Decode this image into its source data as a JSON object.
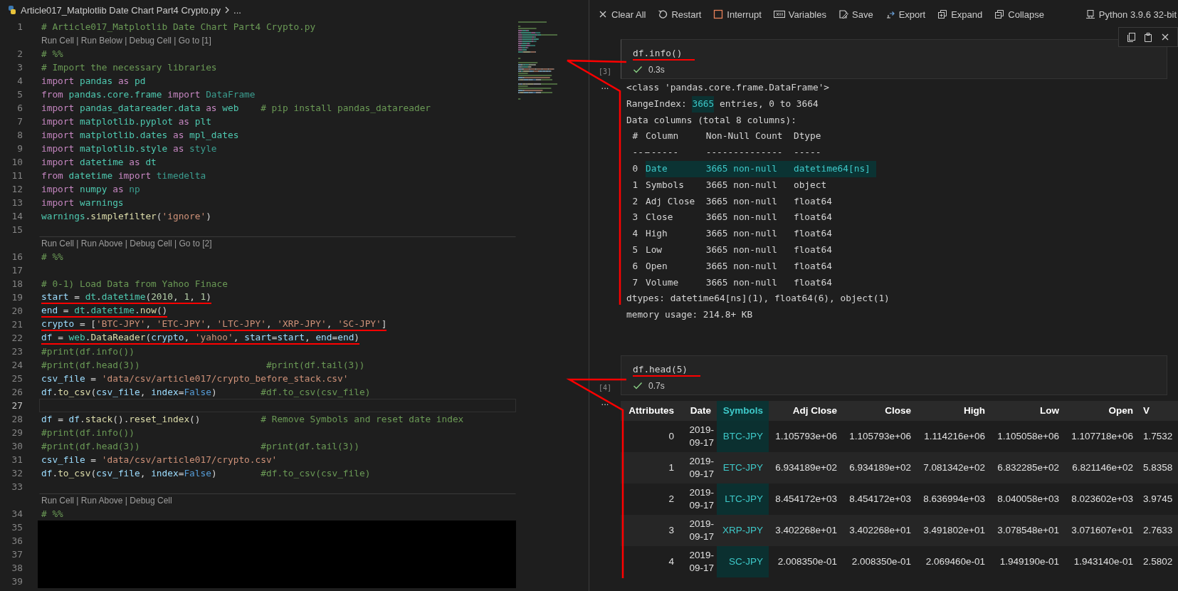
{
  "editor": {
    "breadcrumb": "Article017_Matplotlib Date Chart Part4 Crypto.py",
    "breadcrumb_more": "...",
    "lines": [
      {
        "kind": "code",
        "number": "1",
        "current": false,
        "underlined": false,
        "tokens": [
          {
            "kind": "comment",
            "text": "# Article017_Matplotlib Date Chart Part4 Crypto.py"
          }
        ]
      },
      {
        "kind": "codelens",
        "text": "Run Cell | Run Below | Debug Cell | Go to [1]"
      },
      {
        "kind": "code",
        "number": "2",
        "current": false,
        "underlined": false,
        "tokens": [
          {
            "kind": "comment",
            "text": "# %%"
          }
        ]
      },
      {
        "kind": "code",
        "number": "3",
        "current": false,
        "underlined": false,
        "tokens": [
          {
            "kind": "comment",
            "text": "# Import the necessary libraries"
          }
        ]
      },
      {
        "kind": "code",
        "number": "4",
        "current": false,
        "underlined": false,
        "tokens": [
          {
            "kind": "keyword",
            "text": "import "
          },
          {
            "kind": "module",
            "text": "pandas "
          },
          {
            "kind": "keyword",
            "text": "as "
          },
          {
            "kind": "module",
            "text": "pd"
          }
        ]
      },
      {
        "kind": "code",
        "number": "5",
        "current": false,
        "underlined": false,
        "tokens": [
          {
            "kind": "keyword",
            "text": "from "
          },
          {
            "kind": "module",
            "text": "pandas.core.frame "
          },
          {
            "kind": "keyword",
            "text": "import "
          },
          {
            "kind": "unresolved",
            "text": "DataFrame"
          }
        ]
      },
      {
        "kind": "code",
        "number": "6",
        "current": false,
        "underlined": false,
        "tokens": [
          {
            "kind": "keyword",
            "text": "import "
          },
          {
            "kind": "module",
            "text": "pandas_datareader.data "
          },
          {
            "kind": "keyword",
            "text": "as "
          },
          {
            "kind": "module",
            "text": "web    "
          },
          {
            "kind": "comment",
            "text": "# pip install pandas_datareader"
          }
        ]
      },
      {
        "kind": "code",
        "number": "7",
        "current": false,
        "underlined": false,
        "tokens": [
          {
            "kind": "keyword",
            "text": "import "
          },
          {
            "kind": "module",
            "text": "matplotlib.pyplot "
          },
          {
            "kind": "keyword",
            "text": "as "
          },
          {
            "kind": "module",
            "text": "plt"
          }
        ]
      },
      {
        "kind": "code",
        "number": "8",
        "current": false,
        "underlined": false,
        "tokens": [
          {
            "kind": "keyword",
            "text": "import "
          },
          {
            "kind": "module",
            "text": "matplotlib.dates "
          },
          {
            "kind": "keyword",
            "text": "as "
          },
          {
            "kind": "module",
            "text": "mpl_dates"
          }
        ]
      },
      {
        "kind": "code",
        "number": "9",
        "current": false,
        "underlined": false,
        "tokens": [
          {
            "kind": "keyword",
            "text": "import "
          },
          {
            "kind": "module",
            "text": "matplotlib.style "
          },
          {
            "kind": "keyword",
            "text": "as "
          },
          {
            "kind": "unresolved",
            "text": "style"
          }
        ]
      },
      {
        "kind": "code",
        "number": "10",
        "current": false,
        "underlined": false,
        "tokens": [
          {
            "kind": "keyword",
            "text": "import "
          },
          {
            "kind": "module",
            "text": "datetime "
          },
          {
            "kind": "keyword",
            "text": "as "
          },
          {
            "kind": "module",
            "text": "dt"
          }
        ]
      },
      {
        "kind": "code",
        "number": "11",
        "current": false,
        "underlined": false,
        "tokens": [
          {
            "kind": "keyword",
            "text": "from "
          },
          {
            "kind": "module",
            "text": "datetime "
          },
          {
            "kind": "keyword",
            "text": "import "
          },
          {
            "kind": "unresolved",
            "text": "timedelta"
          }
        ]
      },
      {
        "kind": "code",
        "number": "12",
        "current": false,
        "underlined": false,
        "tokens": [
          {
            "kind": "keyword",
            "text": "import "
          },
          {
            "kind": "module",
            "text": "numpy "
          },
          {
            "kind": "keyword",
            "text": "as "
          },
          {
            "kind": "unresolved",
            "text": "np"
          }
        ]
      },
      {
        "kind": "code",
        "number": "13",
        "current": false,
        "underlined": false,
        "tokens": [
          {
            "kind": "keyword",
            "text": "import "
          },
          {
            "kind": "module",
            "text": "warnings"
          }
        ]
      },
      {
        "kind": "code",
        "number": "14",
        "current": false,
        "underlined": false,
        "tokens": [
          {
            "kind": "module",
            "text": "warnings"
          },
          {
            "kind": "plain",
            "text": "."
          },
          {
            "kind": "function",
            "text": "simplefilter"
          },
          {
            "kind": "plain",
            "text": "("
          },
          {
            "kind": "string",
            "text": "'ignore'"
          },
          {
            "kind": "plain",
            "text": ")"
          }
        ]
      },
      {
        "kind": "code",
        "number": "15",
        "current": false
      },
      {
        "kind": "codelens",
        "text": "Run Cell | Run Above | Debug Cell | Go to [2]"
      },
      {
        "kind": "code",
        "number": "16",
        "current": false,
        "underlined": false,
        "tokens": [
          {
            "kind": "comment",
            "text": "# %%"
          }
        ]
      },
      {
        "kind": "code",
        "number": "17",
        "current": false
      },
      {
        "kind": "code",
        "number": "18",
        "current": false,
        "underlined": false,
        "tokens": [
          {
            "kind": "comment",
            "text": "# 0-1) Load Data from Yahoo Finace"
          }
        ]
      },
      {
        "kind": "code",
        "number": "19",
        "current": false,
        "underlined": true,
        "tokens": [
          {
            "kind": "variable",
            "text": "start"
          },
          {
            "kind": "plain",
            "text": " = "
          },
          {
            "kind": "module",
            "text": "dt"
          },
          {
            "kind": "plain",
            "text": "."
          },
          {
            "kind": "module",
            "text": "datetime"
          },
          {
            "kind": "plain",
            "text": "("
          },
          {
            "kind": "number",
            "text": "2010"
          },
          {
            "kind": "plain",
            "text": ", "
          },
          {
            "kind": "number",
            "text": "1"
          },
          {
            "kind": "plain",
            "text": ", "
          },
          {
            "kind": "number",
            "text": "1"
          },
          {
            "kind": "plain",
            "text": ")"
          }
        ]
      },
      {
        "kind": "code",
        "number": "20",
        "current": false,
        "underlined": true,
        "tokens": [
          {
            "kind": "variable",
            "text": "end"
          },
          {
            "kind": "plain",
            "text": " = "
          },
          {
            "kind": "module",
            "text": "dt"
          },
          {
            "kind": "plain",
            "text": "."
          },
          {
            "kind": "module",
            "text": "datetime"
          },
          {
            "kind": "plain",
            "text": "."
          },
          {
            "kind": "function",
            "text": "now"
          },
          {
            "kind": "plain",
            "text": "()"
          }
        ]
      },
      {
        "kind": "code",
        "number": "21",
        "current": false,
        "underlined": true,
        "tokens": [
          {
            "kind": "variable",
            "text": "crypto"
          },
          {
            "kind": "plain",
            "text": " = ["
          },
          {
            "kind": "string",
            "text": "'BTC-JPY'"
          },
          {
            "kind": "plain",
            "text": ", "
          },
          {
            "kind": "string",
            "text": "'ETC-JPY'"
          },
          {
            "kind": "plain",
            "text": ", "
          },
          {
            "kind": "string",
            "text": "'LTC-JPY'"
          },
          {
            "kind": "plain",
            "text": ", "
          },
          {
            "kind": "string",
            "text": "'XRP-JPY'"
          },
          {
            "kind": "plain",
            "text": ", "
          },
          {
            "kind": "string",
            "text": "'SC-JPY'"
          },
          {
            "kind": "plain",
            "text": "]"
          }
        ]
      },
      {
        "kind": "code",
        "number": "22",
        "current": false,
        "underlined": true,
        "tokens": [
          {
            "kind": "variable",
            "text": "df"
          },
          {
            "kind": "plain",
            "text": " = "
          },
          {
            "kind": "module",
            "text": "web"
          },
          {
            "kind": "plain",
            "text": "."
          },
          {
            "kind": "function",
            "text": "DataReader"
          },
          {
            "kind": "plain",
            "text": "("
          },
          {
            "kind": "variable",
            "text": "crypto"
          },
          {
            "kind": "plain",
            "text": ", "
          },
          {
            "kind": "string",
            "text": "'yahoo'"
          },
          {
            "kind": "plain",
            "text": ", "
          },
          {
            "kind": "variable",
            "text": "start"
          },
          {
            "kind": "plain",
            "text": "="
          },
          {
            "kind": "variable",
            "text": "start"
          },
          {
            "kind": "plain",
            "text": ", "
          },
          {
            "kind": "variable",
            "text": "end"
          },
          {
            "kind": "plain",
            "text": "="
          },
          {
            "kind": "variable",
            "text": "end"
          },
          {
            "kind": "plain",
            "text": ")"
          }
        ]
      },
      {
        "kind": "code",
        "number": "23",
        "current": false,
        "underlined": false,
        "tokens": [
          {
            "kind": "comment",
            "text": "#print(df.info())"
          }
        ]
      },
      {
        "kind": "code",
        "number": "24",
        "current": false,
        "underlined": false,
        "tokens": [
          {
            "kind": "comment",
            "text": "#print(df.head(3))                       #print(df.tail(3))"
          }
        ]
      },
      {
        "kind": "code",
        "number": "25",
        "current": false,
        "underlined": false,
        "tokens": [
          {
            "kind": "variable",
            "text": "csv_file"
          },
          {
            "kind": "plain",
            "text": " = "
          },
          {
            "kind": "string",
            "text": "'data/csv/article017/crypto_before_stack.csv'"
          }
        ]
      },
      {
        "kind": "code",
        "number": "26",
        "current": false,
        "underlined": false,
        "tokens": [
          {
            "kind": "variable",
            "text": "df"
          },
          {
            "kind": "plain",
            "text": "."
          },
          {
            "kind": "function",
            "text": "to_csv"
          },
          {
            "kind": "plain",
            "text": "("
          },
          {
            "kind": "variable",
            "text": "csv_file"
          },
          {
            "kind": "plain",
            "text": ", "
          },
          {
            "kind": "variable",
            "text": "index"
          },
          {
            "kind": "plain",
            "text": "="
          },
          {
            "kind": "constant",
            "text": "False"
          },
          {
            "kind": "plain",
            "text": ")        "
          },
          {
            "kind": "comment",
            "text": "#df.to_csv(csv_file)"
          }
        ]
      },
      {
        "kind": "code",
        "number": "27",
        "current": true
      },
      {
        "kind": "code",
        "number": "28",
        "current": false,
        "underlined": false,
        "tokens": [
          {
            "kind": "variable",
            "text": "df"
          },
          {
            "kind": "plain",
            "text": " = "
          },
          {
            "kind": "variable",
            "text": "df"
          },
          {
            "kind": "plain",
            "text": "."
          },
          {
            "kind": "function",
            "text": "stack"
          },
          {
            "kind": "plain",
            "text": "()."
          },
          {
            "kind": "function",
            "text": "reset_index"
          },
          {
            "kind": "plain",
            "text": "()           "
          },
          {
            "kind": "comment",
            "text": "# Remove Symbols and reset date index"
          }
        ]
      },
      {
        "kind": "code",
        "number": "29",
        "current": false,
        "underlined": false,
        "tokens": [
          {
            "kind": "comment",
            "text": "#print(df.info())"
          }
        ]
      },
      {
        "kind": "code",
        "number": "30",
        "current": false,
        "underlined": false,
        "tokens": [
          {
            "kind": "comment",
            "text": "#print(df.head(3))                      #print(df.tail(3))"
          }
        ]
      },
      {
        "kind": "code",
        "number": "31",
        "current": false,
        "underlined": false,
        "tokens": [
          {
            "kind": "variable",
            "text": "csv_file"
          },
          {
            "kind": "plain",
            "text": " = "
          },
          {
            "kind": "string",
            "text": "'data/csv/article017/crypto.csv'"
          }
        ]
      },
      {
        "kind": "code",
        "number": "32",
        "current": false,
        "underlined": false,
        "tokens": [
          {
            "kind": "variable",
            "text": "df"
          },
          {
            "kind": "plain",
            "text": "."
          },
          {
            "kind": "function",
            "text": "to_csv"
          },
          {
            "kind": "plain",
            "text": "("
          },
          {
            "kind": "variable",
            "text": "csv_file"
          },
          {
            "kind": "plain",
            "text": ", "
          },
          {
            "kind": "variable",
            "text": "index"
          },
          {
            "kind": "plain",
            "text": "="
          },
          {
            "kind": "constant",
            "text": "False"
          },
          {
            "kind": "plain",
            "text": ")        "
          },
          {
            "kind": "comment",
            "text": "#df.to_csv(csv_file)"
          }
        ]
      },
      {
        "kind": "code",
        "number": "33",
        "current": false
      },
      {
        "kind": "codelens",
        "text": "Run Cell | Run Above | Debug Cell"
      },
      {
        "kind": "code",
        "number": "34",
        "current": false,
        "underlined": false,
        "tokens": [
          {
            "kind": "comment",
            "text": "# %%"
          }
        ]
      },
      {
        "kind": "covered",
        "number": "35"
      },
      {
        "kind": "covered",
        "number": "36"
      },
      {
        "kind": "covered",
        "number": "37"
      },
      {
        "kind": "covered",
        "number": "38"
      },
      {
        "kind": "covered",
        "number": "39"
      }
    ]
  },
  "toolbar": {
    "items": [
      "Clear All",
      "Restart",
      "Interrupt",
      "Variables",
      "Save",
      "Export",
      "Expand",
      "Collapse"
    ],
    "kernel": "Python 3.9.6 32-bit"
  },
  "cells": [
    {
      "kind": "info",
      "selected": true,
      "execution_count": "[3]",
      "source": "df.info()",
      "underlined": true,
      "success": true,
      "duration": "0.3s",
      "output_marker": "...",
      "output": {
        "lines_before": [
          [
            {
              "text": "<class 'pandas.core.frame.DataFrame'>",
              "highlighted": false
            }
          ],
          [
            {
              "text": "RangeIndex: ",
              "highlighted": false
            },
            {
              "text": "3665",
              "highlighted": true
            },
            {
              "text": " entries, 0 to 3664",
              "highlighted": false
            }
          ],
          [
            {
              "text": "Data columns (total 8 columns):",
              "highlighted": false
            }
          ]
        ],
        "header": [
          "#",
          "Column",
          "Non-Null Count",
          "Dtype"
        ],
        "rule": [
          "---",
          "------",
          "--------------",
          "-----"
        ],
        "rows": [
          {
            "index": "0",
            "column": "Date",
            "count": "3665 non-null",
            "dtype": "datetime64[ns]",
            "highlighted": true
          },
          {
            "index": "1",
            "column": "Symbols",
            "count": "3665 non-null",
            "dtype": "object",
            "highlighted": false
          },
          {
            "index": "2",
            "column": "Adj Close",
            "count": "3665 non-null",
            "dtype": "float64",
            "highlighted": false
          },
          {
            "index": "3",
            "column": "Close",
            "count": "3665 non-null",
            "dtype": "float64",
            "highlighted": false
          },
          {
            "index": "4",
            "column": "High",
            "count": "3665 non-null",
            "dtype": "float64",
            "highlighted": false
          },
          {
            "index": "5",
            "column": "Low",
            "count": "3665 non-null",
            "dtype": "float64",
            "highlighted": false
          },
          {
            "index": "6",
            "column": "Open",
            "count": "3665 non-null",
            "dtype": "float64",
            "highlighted": false
          },
          {
            "index": "7",
            "column": "Volume",
            "count": "3665 non-null",
            "dtype": "float64",
            "highlighted": false
          }
        ],
        "lines_after": [
          "dtypes: datetime64[ns](1), float64(6), object(1)",
          "memory usage: 214.8+ KB"
        ]
      }
    },
    {
      "kind": "table",
      "selected": false,
      "execution_count": "[4]",
      "source": "df.head(5)",
      "underlined": true,
      "success": true,
      "duration": "0.7s",
      "output_marker": "...",
      "columns": [
        {
          "label": "Attributes",
          "highlighted": false
        },
        {
          "label": "Date",
          "highlighted": false
        },
        {
          "label": "Symbols",
          "highlighted": true
        },
        {
          "label": "Adj Close",
          "highlighted": false
        },
        {
          "label": "Close",
          "highlighted": false
        },
        {
          "label": "High",
          "highlighted": false
        },
        {
          "label": "Low",
          "highlighted": false
        },
        {
          "label": "Open",
          "highlighted": false
        },
        {
          "label": "V",
          "highlighted": false
        }
      ],
      "rows": [
        [
          "0",
          "2019-09-17",
          "BTC-JPY",
          "1.105793e+06",
          "1.105793e+06",
          "1.114216e+06",
          "1.105058e+06",
          "1.107718e+06",
          "1.7532"
        ],
        [
          "1",
          "2019-09-17",
          "ETC-JPY",
          "6.934189e+02",
          "6.934189e+02",
          "7.081342e+02",
          "6.832285e+02",
          "6.821146e+02",
          "5.8358"
        ],
        [
          "2",
          "2019-09-17",
          "LTC-JPY",
          "8.454172e+03",
          "8.454172e+03",
          "8.636994e+03",
          "8.040058e+03",
          "8.023602e+03",
          "3.9745"
        ],
        [
          "3",
          "2019-09-17",
          "XRP-JPY",
          "3.402268e+01",
          "3.402268e+01",
          "3.491802e+01",
          "3.078548e+01",
          "3.071607e+01",
          "2.7633"
        ],
        [
          "4",
          "2019-09-17",
          "SC-JPY",
          "2.008350e-01",
          "2.008350e-01",
          "2.069460e-01",
          "1.949190e-01",
          "1.943140e-01",
          "2.5802"
        ]
      ]
    }
  ]
}
